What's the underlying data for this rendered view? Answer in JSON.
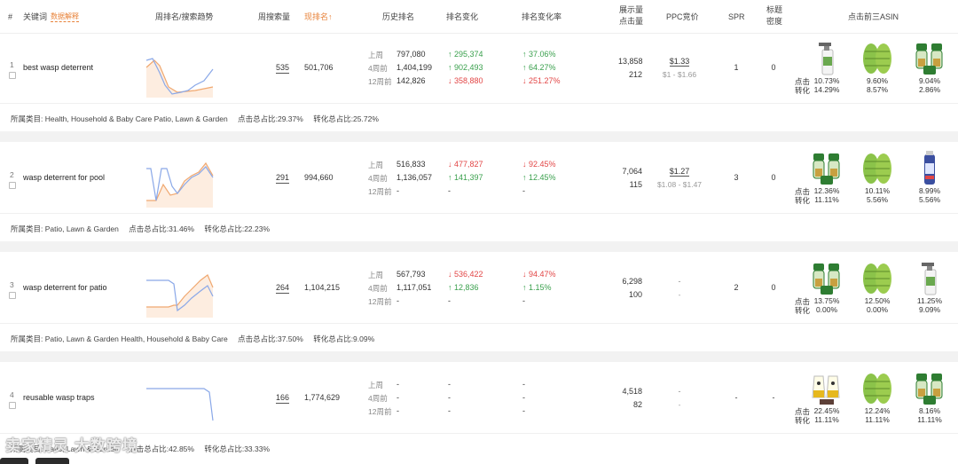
{
  "header": {
    "index": "#",
    "keyword": "关键词",
    "explain": "数据解释",
    "trend": "周排名/搜索趋势",
    "weekly_volume": "周搜索量",
    "current_rank": "现排名↑",
    "history_rank": "历史排名",
    "rank_change": "排名变化",
    "rank_change_rate": "排名变化率",
    "impressions_line1": "展示量",
    "impressions_line2": "点击量",
    "ppc": "PPC竞价",
    "spr": "SPR",
    "title_density_line1": "标题",
    "title_density_line2": "密度",
    "top3_asin": "点击前三ASIN"
  },
  "labels": {
    "last_week": "上周",
    "four_weeks": "4周前",
    "twelve_weeks": "12周前",
    "click": "点击",
    "convert": "转化"
  },
  "colors": {
    "accent": "#e8833a",
    "up": "#3aa04d",
    "down": "#e24646",
    "trend_blue": "#8aa8e8",
    "trend_orange": "#f0a870"
  },
  "rows": [
    {
      "index": "1",
      "keyword": "best wasp deterrent",
      "weekly_volume": "535",
      "current_rank": "501,706",
      "history": [
        "797,080",
        "1,404,199",
        "142,826"
      ],
      "change": [
        {
          "v": "↑ 295,374",
          "d": "up"
        },
        {
          "v": "↑ 902,493",
          "d": "up"
        },
        {
          "v": "↓ 358,880",
          "d": "down"
        }
      ],
      "rate": [
        {
          "v": "↑ 37.06%",
          "d": "up"
        },
        {
          "v": "↑ 64.27%",
          "d": "up"
        },
        {
          "v": "↓ 251.27%",
          "d": "down"
        }
      ],
      "impressions": "13,858",
      "clicks": "212",
      "ppc": "$1.33",
      "ppc_range": "$1 - $1.66",
      "spr": "1",
      "title_density": "0",
      "category_label": "所属类目: Health, Household & Baby Care Patio, Lawn & Garden",
      "click_share": "点击总占比:29.37%",
      "convert_share": "转化总占比:25.72%",
      "asins": [
        {
          "icon": "spray-bottle",
          "click": "10.73%",
          "convert": "14.29%"
        },
        {
          "icon": "green-trap-pair",
          "click": "9.60%",
          "convert": "8.57%"
        },
        {
          "icon": "lantern-trap-set",
          "click": "9.04%",
          "convert": "2.86%"
        }
      ]
    },
    {
      "index": "2",
      "keyword": "wasp deterrent for pool",
      "weekly_volume": "291",
      "current_rank": "994,660",
      "history": [
        "516,833",
        "1,136,057",
        "-"
      ],
      "change": [
        {
          "v": "↓ 477,827",
          "d": "down"
        },
        {
          "v": "↑ 141,397",
          "d": "up"
        },
        {
          "v": "-",
          "d": ""
        }
      ],
      "rate": [
        {
          "v": "↓ 92.45%",
          "d": "down"
        },
        {
          "v": "↑ 12.45%",
          "d": "up"
        },
        {
          "v": "-",
          "d": ""
        }
      ],
      "impressions": "7,064",
      "clicks": "115",
      "ppc": "$1.27",
      "ppc_range": "$1.08 - $1.47",
      "spr": "3",
      "title_density": "0",
      "category_label": "所属类目: Patio, Lawn & Garden",
      "click_share": "点击总占比:31.46%",
      "convert_share": "转化总占比:22.23%",
      "asins": [
        {
          "icon": "lantern-trap-set",
          "click": "12.36%",
          "convert": "11.11%"
        },
        {
          "icon": "green-trap-pair",
          "click": "10.11%",
          "convert": "5.56%"
        },
        {
          "icon": "spray-can",
          "click": "8.99%",
          "convert": "5.56%"
        }
      ]
    },
    {
      "index": "3",
      "keyword": "wasp deterrent for patio",
      "weekly_volume": "264",
      "current_rank": "1,104,215",
      "history": [
        "567,793",
        "1,117,051",
        "-"
      ],
      "change": [
        {
          "v": "↓ 536,422",
          "d": "down"
        },
        {
          "v": "↑ 12,836",
          "d": "up"
        },
        {
          "v": "-",
          "d": ""
        }
      ],
      "rate": [
        {
          "v": "↓ 94.47%",
          "d": "down"
        },
        {
          "v": "↑ 1.15%",
          "d": "up"
        },
        {
          "v": "-",
          "d": ""
        }
      ],
      "impressions": "6,298",
      "clicks": "100",
      "ppc": "-",
      "ppc_range": "-",
      "spr": "2",
      "title_density": "0",
      "category_label": "所属类目: Patio, Lawn & Garden Health, Household & Baby Care",
      "click_share": "点击总占比:37.50%",
      "convert_share": "转化总占比:9.09%",
      "asins": [
        {
          "icon": "lantern-trap-set",
          "click": "13.75%",
          "convert": "0.00%"
        },
        {
          "icon": "green-trap-pair",
          "click": "12.50%",
          "convert": "0.00%"
        },
        {
          "icon": "spray-bottle",
          "click": "11.25%",
          "convert": "9.09%"
        }
      ]
    },
    {
      "index": "4",
      "keyword": "reusable wasp traps",
      "weekly_volume": "166",
      "current_rank": "1,774,629",
      "history": [
        "-",
        "-",
        "-"
      ],
      "change": [
        {
          "v": "-",
          "d": ""
        },
        {
          "v": "-",
          "d": ""
        },
        {
          "v": "-",
          "d": ""
        }
      ],
      "rate": [
        {
          "v": "-",
          "d": ""
        },
        {
          "v": "-",
          "d": ""
        },
        {
          "v": "-",
          "d": ""
        }
      ],
      "impressions": "4,518",
      "clicks": "82",
      "ppc": "-",
      "ppc_range": "-",
      "spr": "-",
      "title_density": "-",
      "category_label": "所属类目: Patio, Lawn & Garden",
      "click_share": "点击总占比:42.85%",
      "convert_share": "转化总占比:33.33%",
      "asins": [
        {
          "icon": "yellow-trap-set",
          "click": "22.45%",
          "convert": "11.11%"
        },
        {
          "icon": "green-trap-pair",
          "click": "12.24%",
          "convert": "11.11%"
        },
        {
          "icon": "lantern-trap-set",
          "click": "8.16%",
          "convert": "11.11%"
        }
      ]
    }
  ],
  "watermark": "卖家精灵 大数跨境"
}
